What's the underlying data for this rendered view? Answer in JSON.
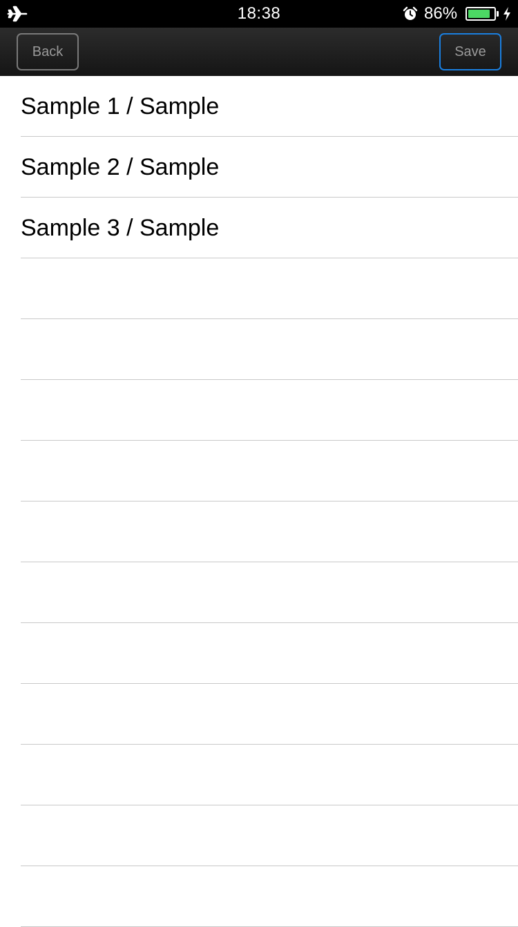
{
  "status_bar": {
    "time": "18:38",
    "battery_percent": "86%",
    "battery_level": 0.86,
    "battery_color": "#4cd964",
    "icons": [
      "airplane-icon",
      "alarm-icon",
      "battery-icon",
      "charging-bolt-icon"
    ]
  },
  "nav_bar": {
    "back_label": "Back",
    "save_label": "Save",
    "save_border_color": "#1a7fe0"
  },
  "list": {
    "items": [
      {
        "label": "Sample 1 / Sample"
      },
      {
        "label": "Sample 2 / Sample"
      },
      {
        "label": "Sample 3 / Sample"
      },
      {
        "label": ""
      },
      {
        "label": ""
      },
      {
        "label": ""
      },
      {
        "label": ""
      },
      {
        "label": ""
      },
      {
        "label": ""
      },
      {
        "label": ""
      },
      {
        "label": ""
      },
      {
        "label": ""
      },
      {
        "label": ""
      },
      {
        "label": ""
      }
    ]
  }
}
